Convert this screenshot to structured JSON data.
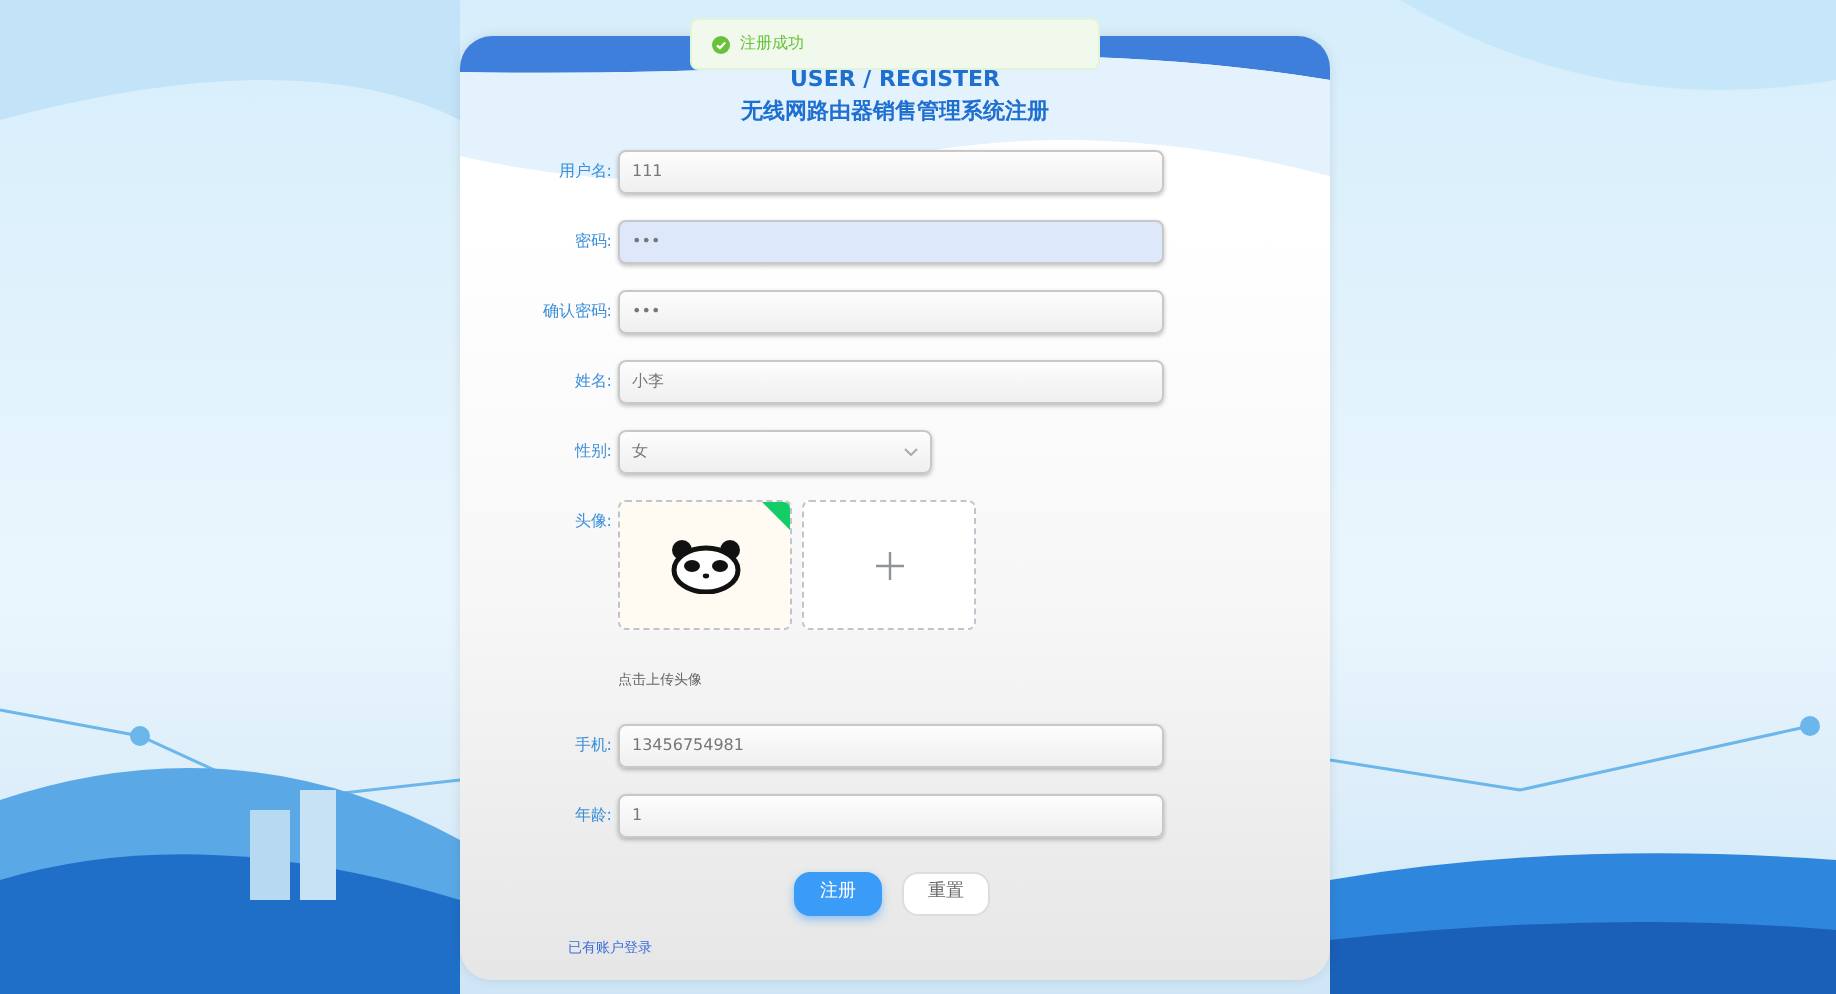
{
  "toast": {
    "text": "注册成功"
  },
  "form": {
    "subtitle": "USER / REGISTER",
    "title": "无线网路由器销售管理系统注册",
    "fields": [
      {
        "kind": "text",
        "label": "用户名:",
        "value": "111",
        "focused": false
      },
      {
        "kind": "text",
        "label": "密码:",
        "value": "•••",
        "focused": true
      },
      {
        "kind": "text",
        "label": "确认密码:",
        "value": "•••",
        "focused": false
      },
      {
        "kind": "text",
        "label": "姓名:",
        "value": "小李",
        "focused": false
      },
      {
        "kind": "select",
        "label": "性别:",
        "value": "女",
        "focused": false
      },
      {
        "kind": "upload",
        "label": "头像:",
        "hint": "点击上传头像"
      },
      {
        "kind": "text",
        "label": "手机:",
        "value": "13456754981",
        "focused": false
      },
      {
        "kind": "text",
        "label": "年龄:",
        "value": "1",
        "focused": false
      }
    ],
    "buttons": [
      {
        "label": "注册",
        "kind": "primary"
      },
      {
        "label": "重置",
        "kind": "plain"
      }
    ],
    "login_link": "已有账户登录"
  }
}
